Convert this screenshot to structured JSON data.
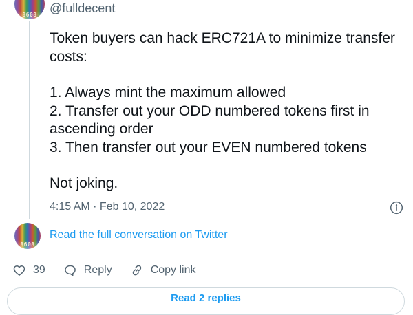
{
  "author": {
    "handle": "@fulldecent",
    "avatar_text": "8608"
  },
  "tweet": {
    "paragraphs": [
      [
        "Token buyers can hack ERC721A to minimize transfer costs:"
      ],
      [
        "1. Always mint the maximum allowed",
        "2. Transfer out your ODD numbered tokens first in ascending order",
        "3. Then transfer out your EVEN numbered tokens"
      ],
      [
        "Not joking."
      ]
    ],
    "timestamp": "4:15 AM · Feb 10, 2022"
  },
  "conversation": {
    "avatar_text": "8608",
    "link_label": "Read the full conversation on Twitter"
  },
  "actions": {
    "like_count": "39",
    "reply_label": "Reply",
    "copy_link_label": "Copy link"
  },
  "more_button_label": "Read 2 replies",
  "colors": {
    "link": "#1d9bf0",
    "secondary_text": "#536471",
    "border": "#cfd9de"
  }
}
